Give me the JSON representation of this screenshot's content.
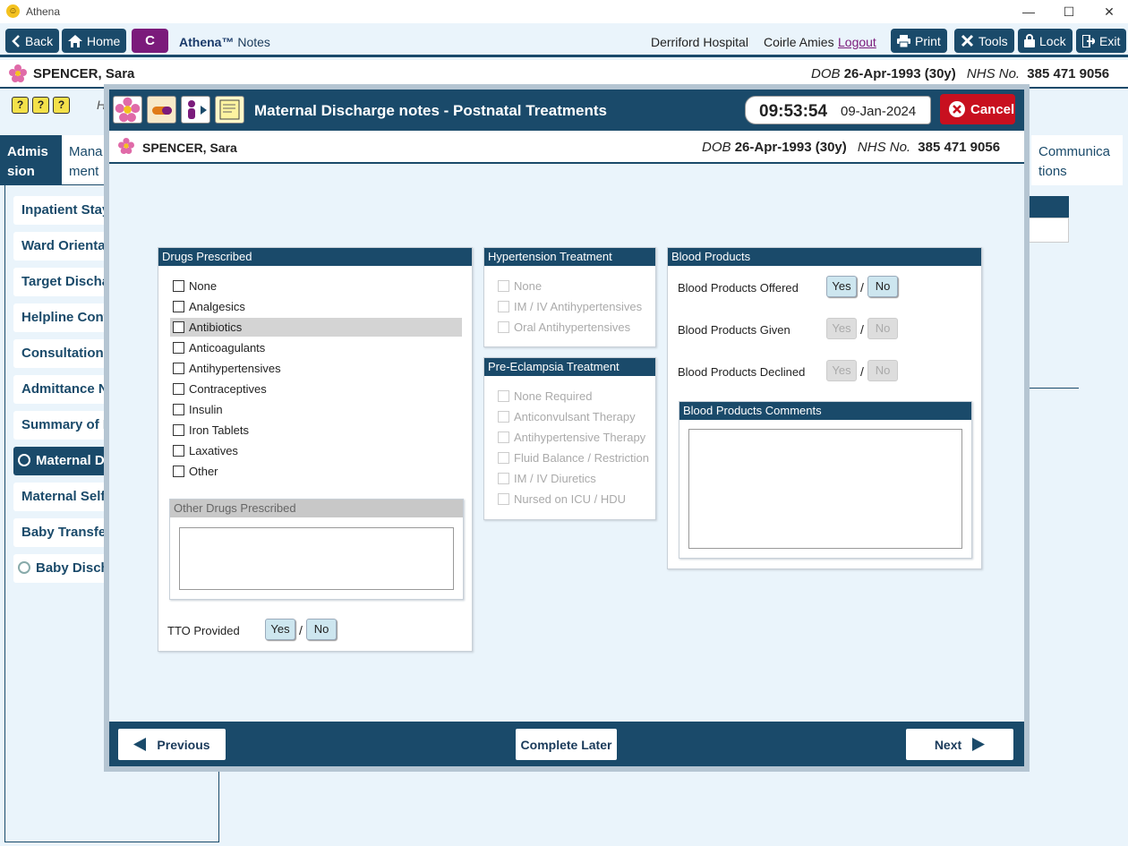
{
  "window": {
    "app_title": "Athena"
  },
  "toolbar": {
    "back": "Back",
    "home": "Home",
    "c_button": "C",
    "athena_brand": "Athena™",
    "notes": "Notes",
    "hospital": "Derriford Hospital",
    "user": "Coirle Amies",
    "logout": "Logout",
    "print": "Print",
    "tools": "Tools",
    "lock": "Lock",
    "exit": "Exit"
  },
  "patient": {
    "name": "SPENCER, Sara",
    "dob_label": "DOB",
    "dob": "26-Apr-1993 (30y)",
    "nhs_label": "NHS No.",
    "nhs": "385 471 9056"
  },
  "background": {
    "tabs": [
      "Admis sion",
      "Mana ment",
      "Communica tions"
    ],
    "header_stub": "H",
    "sidebar": [
      "Inpatient Stay",
      "Ward Orientat",
      "Target Dischar",
      "Helpline Cont",
      "Consultation I",
      "Admittance N",
      "Summary of P",
      "Maternal Di",
      "Maternal Self",
      "Baby Transfer",
      "Baby Discha"
    ]
  },
  "modal": {
    "title": "Maternal Discharge notes - Postnatal Treatments",
    "time": "09:53:54",
    "date": "09-Jan-2024",
    "cancel": "Cancel",
    "drugs": {
      "header": "Drugs Prescribed",
      "items": [
        "None",
        "Analgesics",
        "Antibiotics",
        "Anticoagulants",
        "Antihypertensives",
        "Contraceptives",
        "Insulin",
        "Iron Tablets",
        "Laxatives",
        "Other"
      ],
      "other_header": "Other Drugs Prescribed",
      "tto_label": "TTO Provided"
    },
    "hypertension": {
      "header": "Hypertension Treatment",
      "items": [
        "None",
        "IM / IV Antihypertensives",
        "Oral Antihypertensives"
      ]
    },
    "preeclampsia": {
      "header": "Pre-Eclampsia Treatment",
      "items": [
        "None Required",
        "Anticonvulsant Therapy",
        "Antihypertensive Therapy",
        "Fluid Balance / Restriction",
        "IM / IV Diuretics",
        "Nursed on ICU / HDU"
      ]
    },
    "blood": {
      "header": "Blood Products",
      "offered": "Blood Products Offered",
      "given": "Blood Products Given",
      "declined": "Blood Products Declined",
      "comments_header": "Blood Products Comments"
    },
    "yes": "Yes",
    "no": "No",
    "slash": "/",
    "footer": {
      "previous": "Previous",
      "complete_later": "Complete Later",
      "next": "Next"
    }
  },
  "colors": {
    "primary": "#1a4a6a",
    "purple": "#7b1b7b",
    "cancel": "#c8101f",
    "yesno": "#cde6ef"
  }
}
